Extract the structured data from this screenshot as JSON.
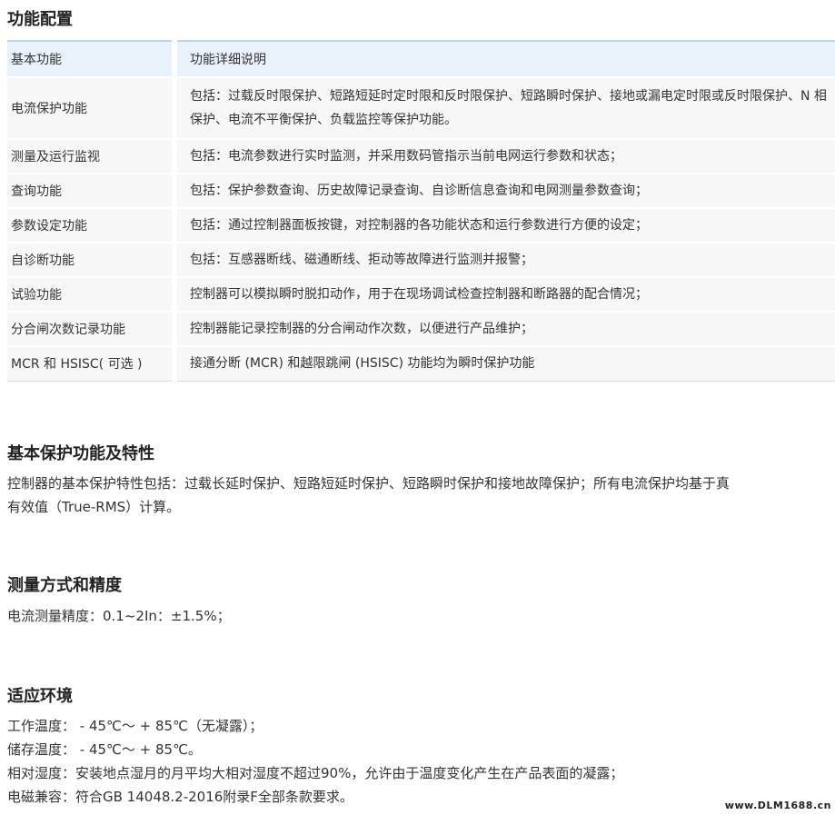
{
  "section_features": {
    "title": "功能配置",
    "headers": [
      "基本功能",
      "功能详细说明"
    ],
    "rows": [
      {
        "name": "电流保护功能",
        "desc": "包括：过载反时限保护、短路短延时定时限和反时限保护、短路瞬时保护、接地或漏电定时限或反时限保护、N 相保护、电流不平衡保护、负载监控等保护功能。"
      },
      {
        "name": "测量及运行监视",
        "desc": "包括：电流参数进行实时监测，并采用数码管指示当前电网运行参数和状态；"
      },
      {
        "name": "查询功能",
        "desc": "包括：保护参数查询、历史故障记录查询、自诊断信息查询和电网测量参数查询；"
      },
      {
        "name": "参数设定功能",
        "desc": "包括：通过控制器面板按键，对控制器的各功能状态和运行参数进行方便的设定；"
      },
      {
        "name": "自诊断功能",
        "desc": "包括：互感器断线、磁通断线、拒动等故障进行监测并报警；"
      },
      {
        "name": "试验功能",
        "desc": "控制器可以模拟瞬时脱扣动作，用于在现场调试检查控制器和断路器的配合情况；"
      },
      {
        "name": "分合闸次数记录功能",
        "desc": "控制器能记录控制器的分合闸动作次数，以便进行产品维护；"
      },
      {
        "name": "MCR 和 HSISC( 可选 )",
        "desc": "接通分断 (MCR) 和越限跳闸 (HSISC) 功能均为瞬时保护功能"
      }
    ]
  },
  "section_protection": {
    "title": "基本保护功能及特性",
    "lines": [
      "控制器的基本保护特性包括：过载长延时保护、短路短延时保护、短路瞬时保护和接地故障保护；所有电流保护均基于真",
      "有效值（True-RMS）计算。"
    ]
  },
  "section_measurement": {
    "title": "测量方式和精度",
    "lines": [
      "电流测量精度：0.1~2In：±1.5%；"
    ]
  },
  "section_environment": {
    "title": "适应环境",
    "lines": [
      "工作温度：  - 45℃～ + 85℃（无凝露）；",
      "储存温度：  - 45℃～ + 85℃。",
      "相对湿度：安装地点湿月的月平均大相对湿度不超过90%，允许由于温度变化产生在产品表面的凝露；",
      "电磁兼容：符合GB 14048.2-2016附录F全部条款要求。"
    ]
  },
  "watermark": "www.DLM1688.cn"
}
